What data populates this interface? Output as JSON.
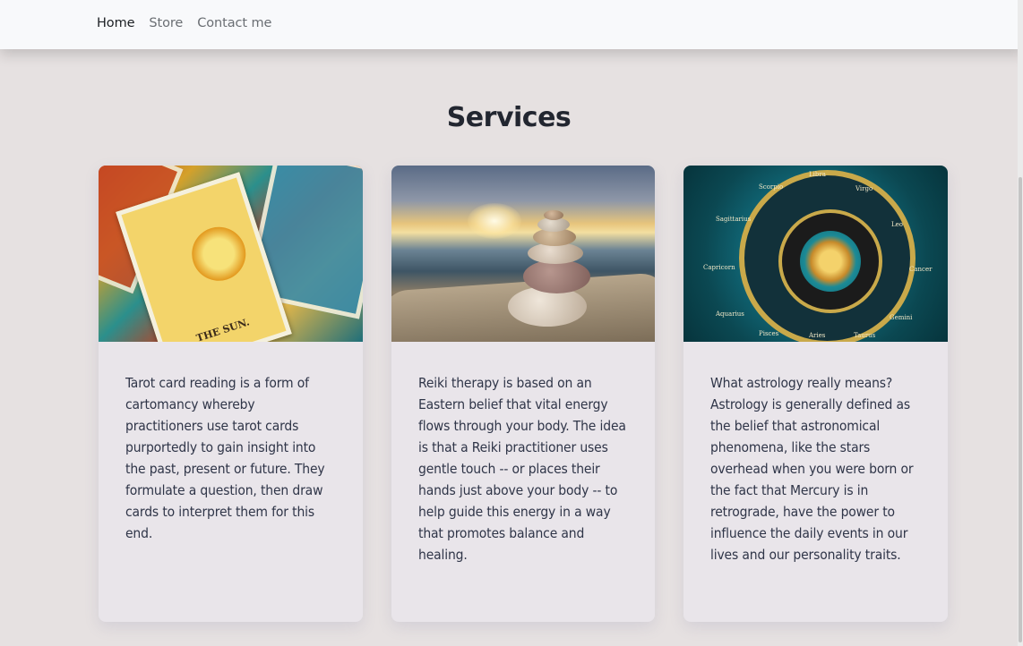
{
  "nav": {
    "links": [
      "Home",
      "Store",
      "Contact me"
    ],
    "active": "Home"
  },
  "main": {
    "title": "Services",
    "cards": [
      {
        "image": "tarot-cards-image",
        "image_caption": "THE SUN.",
        "text": "Tarot card reading is a form of cartomancy whereby practitioners use tarot cards purportedly to gain insight into the past, present or future. They formulate a question, then draw cards to interpret them for this end."
      },
      {
        "image": "stacked-stones-image",
        "text": "Reiki therapy is based on an Eastern belief that vital energy flows through your body. The idea is that a Reiki practitioner uses gentle touch -- or places their hands just above your body -- to help guide this energy in a way that promotes balance and healing."
      },
      {
        "image": "zodiac-wheel-image",
        "zodiac_labels": [
          "Libra",
          "Virgo",
          "Leo",
          "Cancer",
          "Gemini",
          "Taurus",
          "Aries",
          "Pisces",
          "Aquarius",
          "Capricorn",
          "Sagittarius",
          "Scorpio"
        ],
        "text": "What astrology really means? Astrology is generally defined as the belief that astronomical phenomena, like the stars overhead when you were born or the fact that Mercury is in retrograde, have the power to influence the daily events in our lives and our personality traits."
      }
    ]
  },
  "colors": {
    "page_background": "#e6e1e1",
    "navbar_background": "#f8f9fb",
    "card_background": "#e9e5ea",
    "text": "#2f3548"
  }
}
